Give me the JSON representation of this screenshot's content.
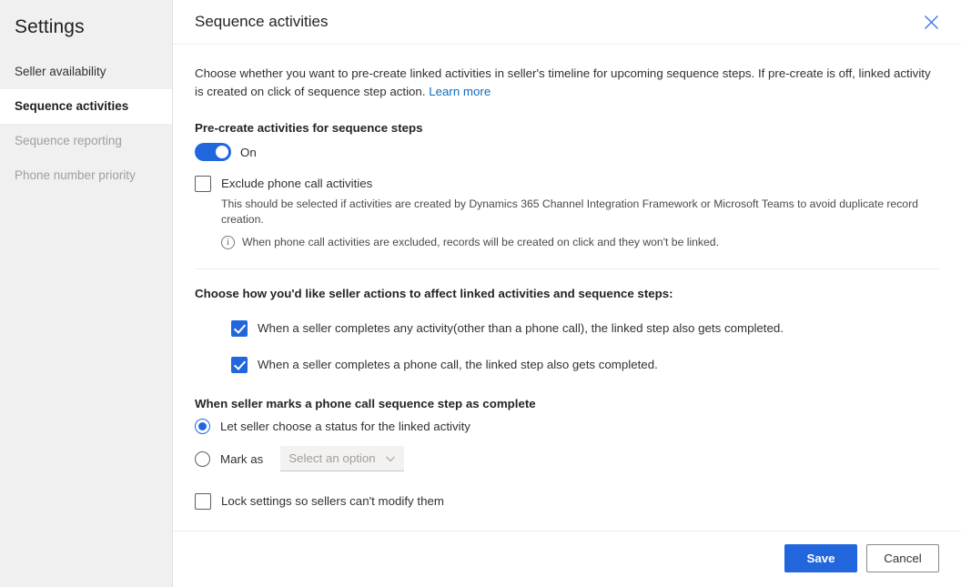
{
  "sidebar": {
    "title": "Settings",
    "items": [
      {
        "label": "Seller availability",
        "state": "normal"
      },
      {
        "label": "Sequence activities",
        "state": "selected"
      },
      {
        "label": "Sequence reporting",
        "state": "disabled"
      },
      {
        "label": "Phone number priority",
        "state": "disabled"
      }
    ]
  },
  "panel": {
    "title": "Sequence activities",
    "close_icon": "close-icon",
    "intro_text": "Choose whether you want to pre-create linked activities in seller's timeline for upcoming sequence steps. If pre-create is off, linked activity is created on click of sequence step action. ",
    "learn_more": "Learn more"
  },
  "precreate": {
    "label": "Pre-create activities for sequence steps",
    "toggle_state": "On",
    "toggle_on": true
  },
  "exclude": {
    "label": "Exclude phone call activities",
    "checked": false,
    "description": "This should be selected if activities are created by Dynamics 365 Channel Integration Framework or Microsoft Teams to avoid duplicate record creation.",
    "info_icon": "info-icon",
    "info_text": "When phone call activities are excluded, records will be created on click and they won't be linked."
  },
  "seller_actions": {
    "heading": "Choose how you'd like seller actions to affect linked activities and sequence steps:",
    "options": [
      {
        "label": "When a seller completes any activity(other than a phone call), the linked step also gets completed.",
        "checked": true
      },
      {
        "label": "When a seller completes a phone call, the linked step also gets completed.",
        "checked": true
      }
    ]
  },
  "phone_complete": {
    "heading": "When seller marks a phone call sequence step as complete",
    "radio_let_seller": {
      "label": "Let seller choose a status for the linked activity",
      "selected": true
    },
    "radio_mark_as": {
      "label": "Mark as",
      "selected": false
    },
    "dropdown": {
      "placeholder": "Select an option",
      "value": "Select an option",
      "chevron_icon": "chevron-down-icon",
      "disabled": true
    }
  },
  "lock": {
    "label": "Lock settings so sellers can't modify them",
    "checked": false
  },
  "footer": {
    "save_label": "Save",
    "cancel_label": "Cancel"
  },
  "colors": {
    "accent": "#2266dd",
    "link": "#0f6cbd",
    "sidebar_bg": "#f0f0f0",
    "divider": "#ededed"
  }
}
